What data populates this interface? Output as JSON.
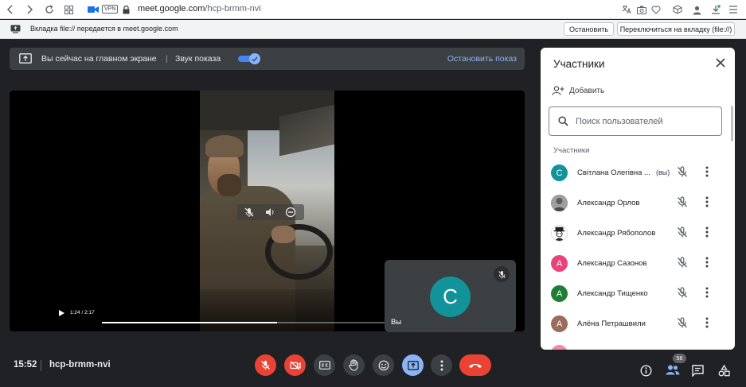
{
  "browser": {
    "url_host": "meet.google.com",
    "url_path": "/hcp-brmm-nvi",
    "vpn_label": "VPN"
  },
  "infobar": {
    "message": "Вкладка file:// передается в meet.google.com",
    "stop_label": "Остановить",
    "switch_label": "Переключиться на вкладку (file://)"
  },
  "banner": {
    "presenting_text": "Вы сейчас на главном экране",
    "audio_label": "Звук показа",
    "audio_on": true,
    "stop_label": "Остановить показ"
  },
  "video": {
    "time": "1:24 / 2:17",
    "progress": 0.61
  },
  "self_tile": {
    "initial": "С",
    "name": "Вы",
    "avatar_color": "#12939a"
  },
  "panel": {
    "title": "Участники",
    "add_label": "Добавить",
    "search_placeholder": "Поиск пользователей",
    "section_label": "Участники",
    "participants": [
      {
        "name": "Світлана Олегівна ...",
        "you_tag": "(вы)",
        "initial": "С",
        "color": "#12939a",
        "avatar": "letter"
      },
      {
        "name": "Александр Орлов",
        "you_tag": "",
        "initial": "",
        "color": "#8a8a8a",
        "avatar": "photo"
      },
      {
        "name": "Александр Рябополов",
        "you_tag": "",
        "initial": "",
        "color": "#ffffff",
        "avatar": "cartoon"
      },
      {
        "name": "Александр Сазонов",
        "you_tag": "",
        "initial": "А",
        "color": "#e8437b",
        "avatar": "letter"
      },
      {
        "name": "Александр Тищенко",
        "you_tag": "",
        "initial": "А",
        "color": "#1e7e34",
        "avatar": "letter"
      },
      {
        "name": "Алёна Петрашвили",
        "you_tag": "",
        "initial": "А",
        "color": "#9c6b5a",
        "avatar": "letter"
      }
    ]
  },
  "bottom": {
    "time": "15:52",
    "meeting_code": "hcp-brmm-nvi",
    "participant_count": "56"
  },
  "colors": {
    "background": "#202124",
    "danger": "#ea4335",
    "accent": "#8ab4f8"
  }
}
